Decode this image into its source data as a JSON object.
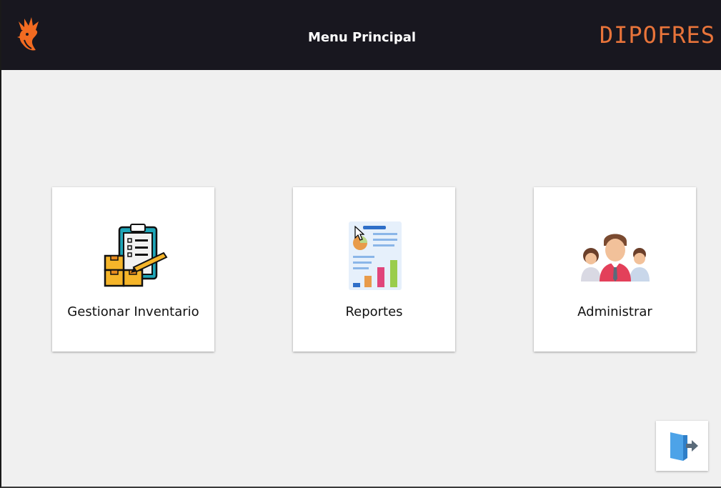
{
  "header": {
    "title": "Menu Principal",
    "brand": "DIPOFRES",
    "logo_icon": "rooster-icon",
    "background": "#18171f",
    "brand_color": "#e8743a"
  },
  "menu": [
    {
      "label": "Gestionar Inventario",
      "icon": "inventory-clipboard-icon"
    },
    {
      "label": "Reportes",
      "icon": "report-chart-icon"
    },
    {
      "label": "Administrar",
      "icon": "users-group-icon"
    }
  ],
  "exit_button": {
    "icon": "exit-door-icon"
  }
}
